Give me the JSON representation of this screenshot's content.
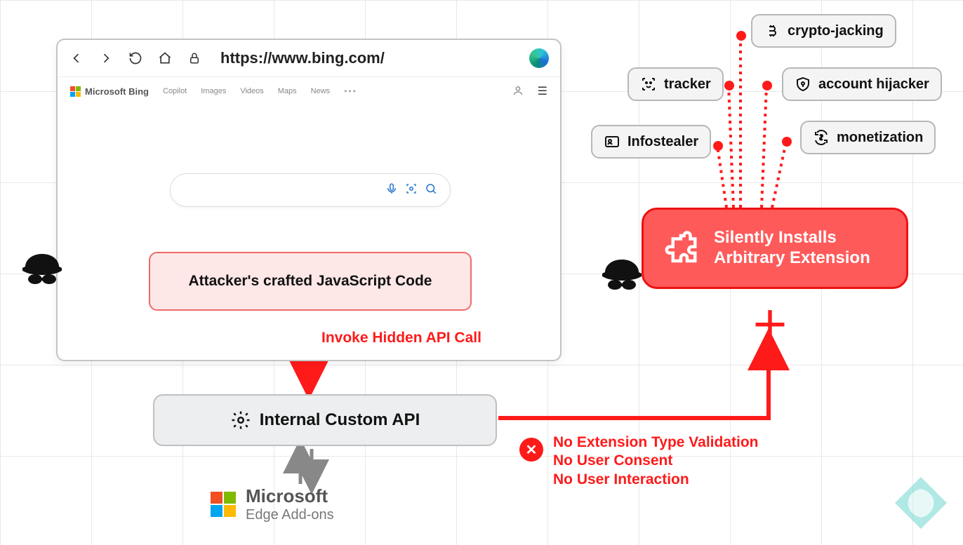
{
  "browser": {
    "url": "https://www.bing.com/",
    "brand": "Microsoft Bing",
    "nav": {
      "copilot": "Copilot",
      "images": "Images",
      "videos": "Videos",
      "maps": "Maps",
      "news": "News"
    }
  },
  "attacker_code": "Attacker's crafted JavaScript Code",
  "invoke_label": "Invoke Hidden API Call",
  "api_box": "Internal Custom API",
  "addons": {
    "line1": "Microsoft",
    "line2": "Edge Add-ons"
  },
  "install_box": {
    "line1": "Silently Installs",
    "line2": "Arbitrary Extension"
  },
  "tags": {
    "crypto": "crypto-jacking",
    "tracker": "tracker",
    "hijack": "account hijacker",
    "info": "Infostealer",
    "monet": "monetization"
  },
  "noconsent": {
    "l1": "No Extension Type Validation",
    "l2": "No User Consent",
    "l3": "No User Interaction"
  },
  "colors": {
    "red": "#ff1a1a",
    "grey": "#888"
  }
}
